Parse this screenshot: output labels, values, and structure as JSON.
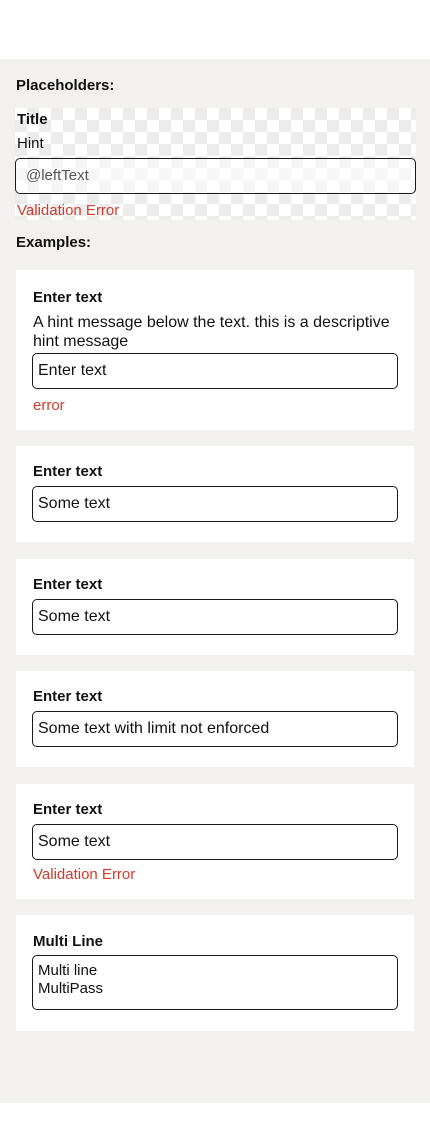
{
  "placeholders": {
    "section_label": "Placeholders:",
    "title": "Title",
    "hint": "Hint",
    "field_text": "@leftText",
    "error": "Validation Error"
  },
  "examples": {
    "section_label": "Examples:",
    "cards": [
      {
        "label": "Enter text",
        "hint": "A hint message below the text. this is a descriptive hint message",
        "value": "Enter text",
        "error": "error"
      },
      {
        "label": "Enter text",
        "value": "Some text"
      },
      {
        "label": "Enter text",
        "value": "Some text"
      },
      {
        "label": "Enter text",
        "value": "Some text with limit not enforced"
      },
      {
        "label": "Enter text",
        "value": "Some text",
        "error": "Validation Error"
      },
      {
        "label": "Multi Line",
        "value_lines": [
          "Multi line",
          "MultiPass"
        ]
      }
    ]
  },
  "colors": {
    "error": "#d13b2a",
    "background": "#f2f1ef",
    "card": "#ffffff",
    "border": "#1a1a1a"
  }
}
